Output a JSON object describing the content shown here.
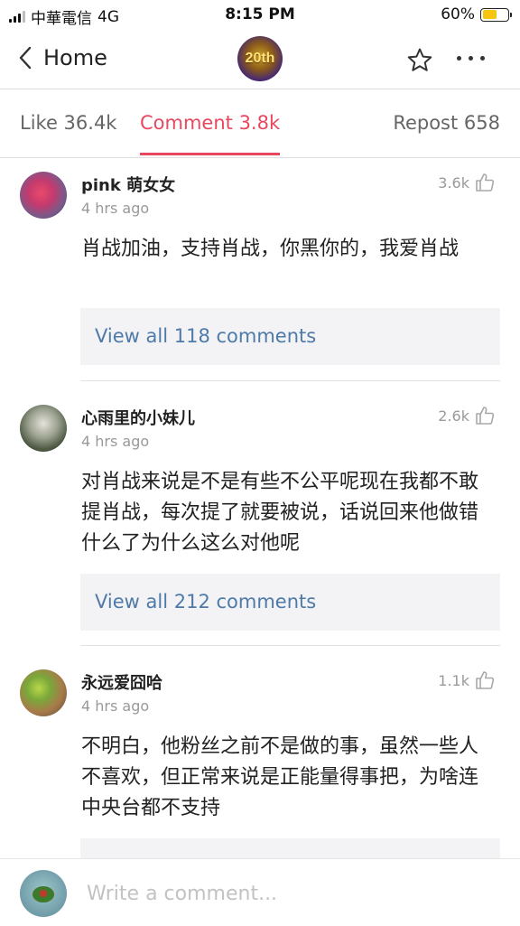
{
  "status_bar": {
    "carrier": "中華電信",
    "network": "4G",
    "time": "8:15 PM",
    "battery": "60%",
    "battery_level": 0.6,
    "battery_color": "#f6c510"
  },
  "nav": {
    "back_label": "Home",
    "logo_text": "20th"
  },
  "tabs": [
    {
      "label": "Like 36.4k"
    },
    {
      "label": "Comment 3.8k"
    },
    {
      "label": "Repost 658"
    }
  ],
  "accent_color": "#e8485f",
  "comments": [
    {
      "name": "pink 萌女女",
      "time": "4 hrs ago",
      "likes": "3.6k",
      "text": "肖战加油，支持肖战，你黑你的，我爱肖战",
      "view_all": "View all 118 comments"
    },
    {
      "name": "心雨里的小妹儿",
      "time": "4 hrs ago",
      "likes": "2.6k",
      "text": "对肖战来说是不是有些不公平呢现在我都不敢提肖战，每次提了就要被说，话说回来他做错什么了为什么这么对他呢",
      "view_all": "View all 212 comments"
    },
    {
      "name": "永远爱囧哈",
      "time": "4 hrs ago",
      "likes": "1.1k",
      "text": "不明白，他粉丝之前不是做的事，虽然一些人不喜欢，但正常来说是正能量得事把，为啥连中央台都不支持"
    }
  ],
  "composer": {
    "placeholder": "Write a comment..."
  }
}
